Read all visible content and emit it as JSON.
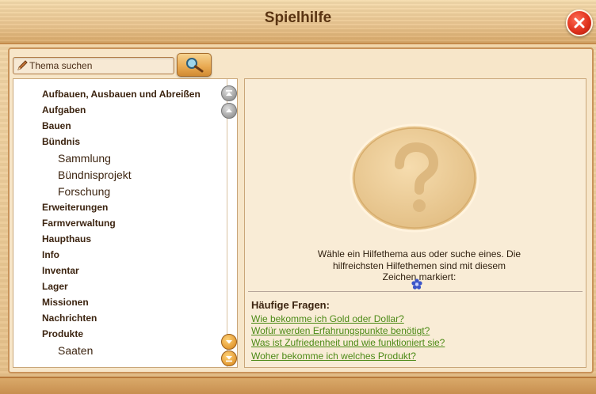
{
  "window": {
    "title": "Spielhilfe"
  },
  "search": {
    "placeholder": "Thema suchen"
  },
  "topics": [
    {
      "label": "Aufbauen, Ausbauen und Abreißen",
      "sub": false
    },
    {
      "label": "Aufgaben",
      "sub": false
    },
    {
      "label": "Bauen",
      "sub": false
    },
    {
      "label": "Bündnis",
      "sub": false
    },
    {
      "label": "Sammlung",
      "sub": true
    },
    {
      "label": "Bündnisprojekt",
      "sub": true
    },
    {
      "label": "Forschung",
      "sub": true
    },
    {
      "label": "Erweiterungen",
      "sub": false
    },
    {
      "label": "Farmverwaltung",
      "sub": false
    },
    {
      "label": "Haupthaus",
      "sub": false
    },
    {
      "label": "Info",
      "sub": false
    },
    {
      "label": "Inventar",
      "sub": false
    },
    {
      "label": "Lager",
      "sub": false
    },
    {
      "label": "Missionen",
      "sub": false
    },
    {
      "label": "Nachrichten",
      "sub": false
    },
    {
      "label": "Produkte",
      "sub": false
    },
    {
      "label": "Saaten",
      "sub": true
    }
  ],
  "help": {
    "hint_line1": "Wähle ein Hilfethema aus oder suche eines. Die",
    "hint_line2": "hilfreichsten Hilfethemen sind mit diesem",
    "hint_line3": "Zeichen markiert:"
  },
  "faq": {
    "title": "Häufige Fragen:",
    "links": [
      "Wie bekomme ich Gold oder Dollar?",
      "Wofür werden Erfahrungspunkte benötigt?",
      "Was ist Zufriedenheit und wie funktioniert sie?",
      "Woher bekomme ich welches Produkt?"
    ]
  },
  "colors": {
    "link": "#4c8a16",
    "wood": "#e6c088",
    "close": "#e0321d",
    "marker": "#3b55c9"
  },
  "icons": {
    "close": "close-icon",
    "search": "magnifier-icon",
    "pencil": "pencil-icon",
    "placeholder": "question-coin-icon",
    "marker": "flower-icon"
  }
}
